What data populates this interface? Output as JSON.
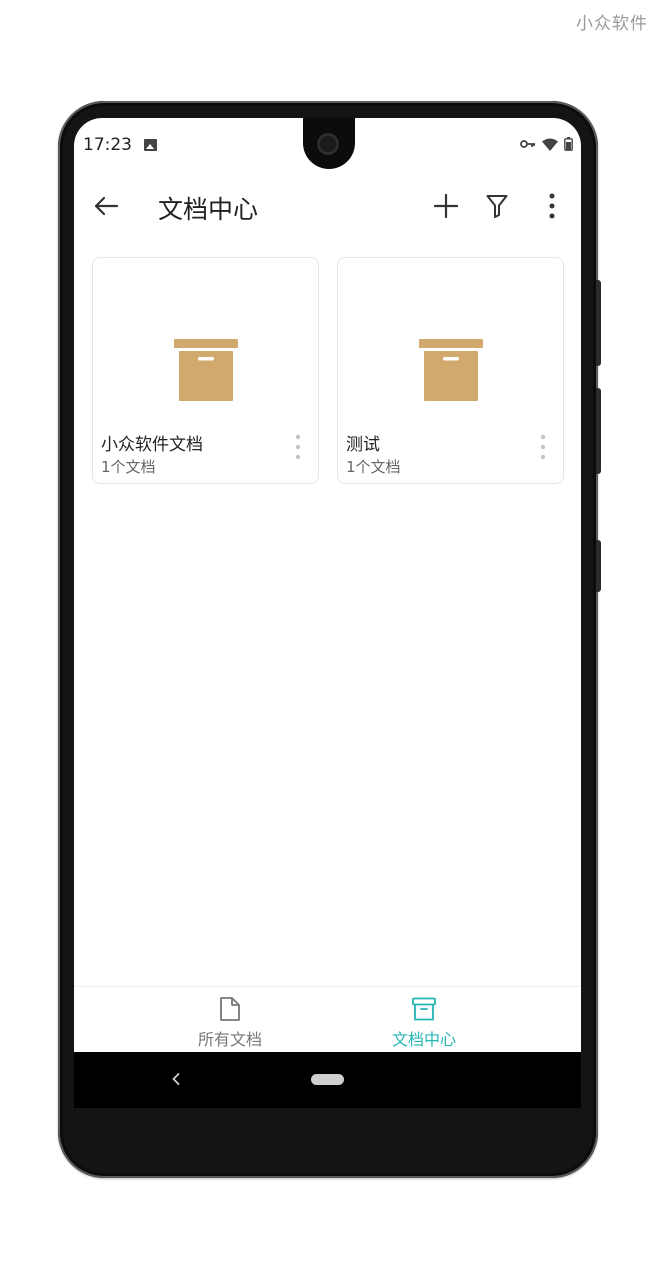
{
  "watermark": "小众软件",
  "status_bar": {
    "time": "17:23"
  },
  "toolbar": {
    "title": "文档中心",
    "icons": [
      "back-arrow-icon",
      "add-icon",
      "filter-icon",
      "more-vert-icon"
    ]
  },
  "folders": [
    {
      "name": "小众软件文档",
      "count": "1个文档"
    },
    {
      "name": "测试",
      "count": "1个文档"
    }
  ],
  "bottom_nav": {
    "items": [
      {
        "label": "所有文档",
        "icon": "file-icon",
        "active": false
      },
      {
        "label": "文档中心",
        "icon": "archive-icon",
        "active": true
      }
    ]
  },
  "colors": {
    "accent": "#26b5b5",
    "folder_icon": "#d2a96c",
    "inactive": "#777777"
  }
}
